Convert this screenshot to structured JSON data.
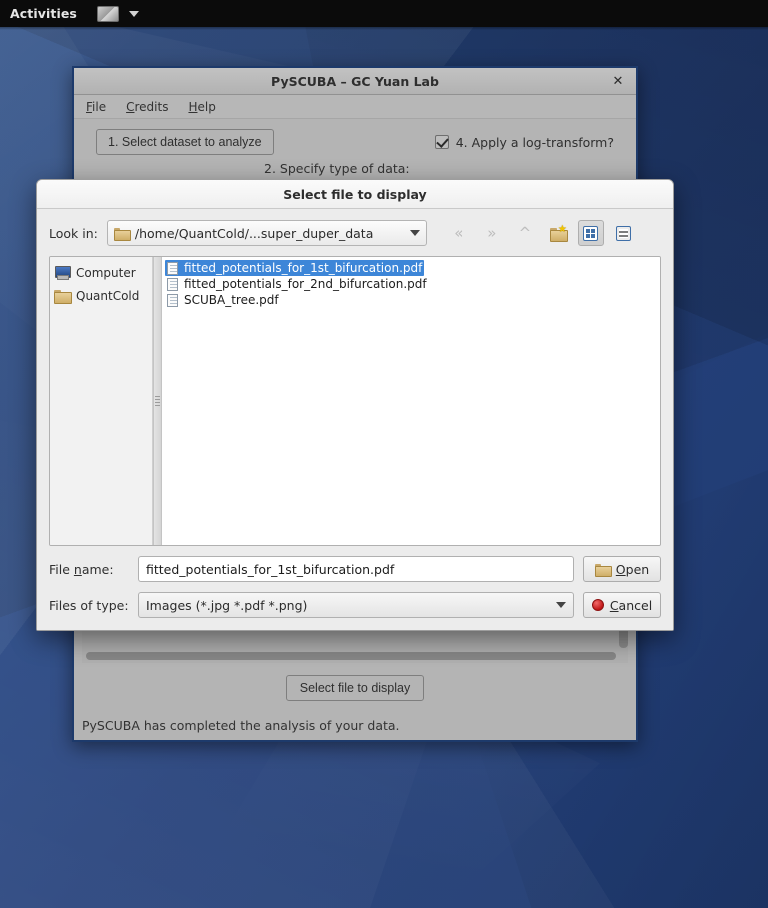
{
  "topbar": {
    "activities": "Activities",
    "app_icon": "window-icon",
    "dropdown_icon": "chevron-down-icon"
  },
  "main_window": {
    "title": "PySCUBA – GC Yuan Lab",
    "close_icon": "✕",
    "menu": [
      {
        "label": "File",
        "mnemonic": "F"
      },
      {
        "label": "Credits",
        "mnemonic": "C"
      },
      {
        "label": "Help",
        "mnemonic": "H"
      }
    ],
    "step1_button": "1. Select dataset to analyze",
    "step2_label": "2. Specify type of data:",
    "step4_checkbox_label": "4. Apply a log-transform?",
    "step4_checked": true,
    "select_file_button": "Select file to display",
    "status_text": "PySCUBA has completed the analysis of your data."
  },
  "dialog": {
    "title": "Select file to display",
    "lookin_label": "Look in:",
    "lookin_value": "/home/QuantCold/...super_duper_data",
    "lookin_folder_icon": "folder-icon",
    "toolbar": [
      {
        "name": "back-icon",
        "glyph": "«",
        "enabled": false
      },
      {
        "name": "forward-icon",
        "glyph": "»",
        "enabled": false
      },
      {
        "name": "parent-directory-icon",
        "glyph": "⌃",
        "enabled": false
      },
      {
        "name": "new-folder-icon",
        "glyph": "new-folder",
        "enabled": true
      },
      {
        "name": "list-view-icon",
        "glyph": "grid",
        "enabled": true,
        "pressed": true
      },
      {
        "name": "detail-view-icon",
        "glyph": "detail",
        "enabled": true,
        "pressed": false
      }
    ],
    "sidebar": [
      {
        "label": "Computer",
        "icon": "computer-icon"
      },
      {
        "label": "QuantCold",
        "icon": "home-folder-icon"
      }
    ],
    "files": [
      {
        "name": "fitted_potentials_for_1st_bifurcation.pdf",
        "selected": true
      },
      {
        "name": "fitted_potentials_for_2nd_bifurcation.pdf",
        "selected": false
      },
      {
        "name": "SCUBA_tree.pdf",
        "selected": false
      }
    ],
    "filename_label_pre": "File ",
    "filename_label_mnemonic": "n",
    "filename_label_post": "ame:",
    "filename_value": "fitted_potentials_for_1st_bifurcation.pdf",
    "filetype_label": "Files of type:",
    "filetype_value": "Images (*.jpg *.pdf *.png)",
    "open_button_pre": "",
    "open_button_mnemonic": "O",
    "open_button_post": "pen",
    "cancel_button_pre": "",
    "cancel_button_mnemonic": "C",
    "cancel_button_post": "ancel"
  },
  "colors": {
    "selection_blue": "#3d86d8",
    "desktop_blue": "#2a4a82",
    "window_border": "#1d3a6b",
    "window_gray": "#b4b4b4",
    "dialog_gray": "#ececec",
    "cancel_red": "#c01616"
  }
}
